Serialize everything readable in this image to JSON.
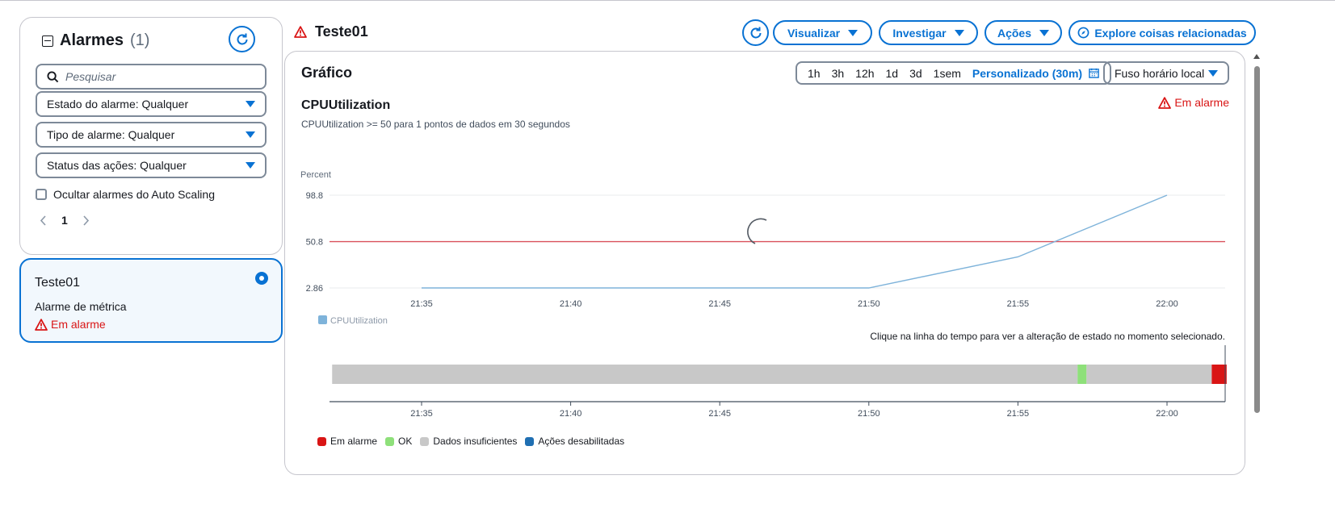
{
  "sidebar": {
    "title": "Alarmes",
    "count": "(1)",
    "search_placeholder": "Pesquisar",
    "filters": [
      "Estado do alarme: Qualquer",
      "Tipo de alarme: Qualquer",
      "Status das ações: Qualquer"
    ],
    "hide_autoscaling_label": "Ocultar alarmes do Auto Scaling",
    "page": "1",
    "alarm_card": {
      "name": "Teste01",
      "type": "Alarme de métrica",
      "state": "Em alarme"
    }
  },
  "header": {
    "title": "Teste01",
    "buttons": {
      "visualize": "Visualizar",
      "investigate": "Investigar",
      "actions": "Ações",
      "explore": "Explore coisas relacionadas"
    }
  },
  "graph": {
    "heading": "Gráfico",
    "ranges": [
      "1h",
      "3h",
      "12h",
      "1d",
      "3d",
      "1sem"
    ],
    "custom_range": "Personalizado (30m)",
    "timezone": "Fuso horário local",
    "metric_title": "CPUUtilization",
    "metric_desc": "CPUUtilization >= 50 para 1 pontos de dados em 30 segundos",
    "state_badge": "Em alarme",
    "timeline_hint": "Clique na linha do tempo para ver a alteração de estado no momento selecionado.",
    "legend": [
      {
        "label": "Em alarme",
        "color": "#d91515"
      },
      {
        "label": "OK",
        "color": "#8ee07a"
      },
      {
        "label": "Dados insuficientes",
        "color": "#c8c8c8"
      },
      {
        "label": "Ações desabilitadas",
        "color": "#1f6fb2"
      }
    ]
  },
  "chart_data": {
    "type": "line",
    "ylabel": "Percent",
    "y_ticks": [
      "98.8",
      "50.8",
      "2.86"
    ],
    "ylim": [
      2.86,
      98.8
    ],
    "x_ticks": [
      "21:35",
      "21:40",
      "21:45",
      "21:50",
      "21:55",
      "22:00"
    ],
    "threshold": 50.8,
    "series": [
      {
        "name": "CPUUtilization",
        "color": "#7eb3da",
        "x": [
          "21:35",
          "21:40",
          "21:45",
          "21:50",
          "21:55",
          "22:00"
        ],
        "values": [
          2.86,
          2.86,
          2.86,
          2.86,
          35,
          98.8
        ]
      }
    ],
    "timeline": [
      {
        "state": "Dados insuficientes",
        "color": "#c8c8c8",
        "from": "21:32",
        "to": "21:57"
      },
      {
        "state": "OK",
        "color": "#8ee07a",
        "from": "21:57",
        "to": "21:57.3"
      },
      {
        "state": "Dados insuficientes",
        "color": "#c8c8c8",
        "from": "21:57.3",
        "to": "22:01.5"
      },
      {
        "state": "Em alarme",
        "color": "#d91515",
        "from": "22:01.5",
        "to": "22:02"
      }
    ]
  }
}
